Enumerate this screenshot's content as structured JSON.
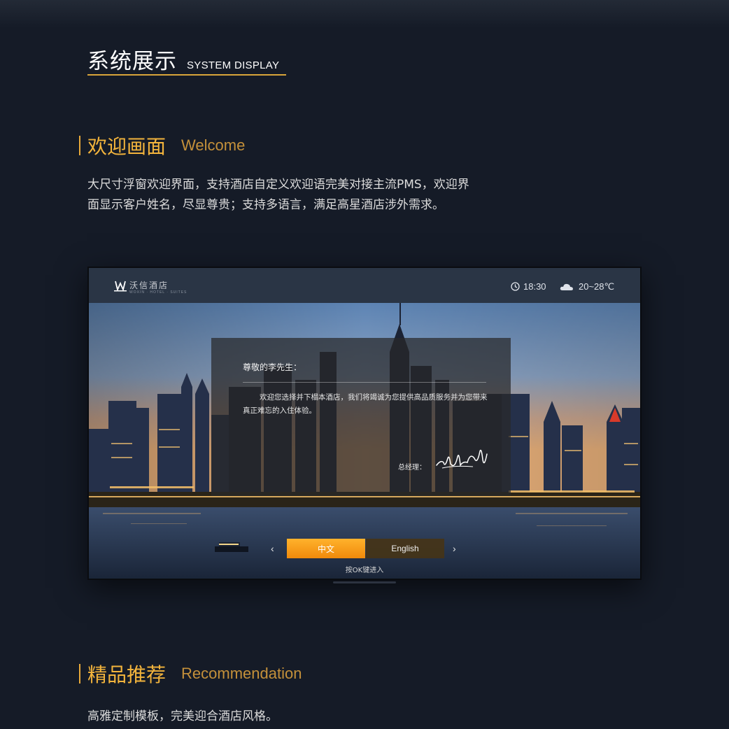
{
  "header": {
    "title_zh": "系统展示",
    "title_en": "SYSTEM DISPLAY"
  },
  "section_welcome": {
    "title_zh": "欢迎画面",
    "title_en": "Welcome",
    "description_line1": "大尺寸浮窗欢迎界面，支持酒店自定义欢迎语完美对接主流PMS，欢迎界",
    "description_line2": "面显示客户姓名，尽显尊贵；支持多语言，满足高星酒店涉外需求。"
  },
  "tv": {
    "logo_text": "沃信酒店",
    "logo_sub": "WOXIN · HOTEL · SUITES",
    "time": "18:30",
    "temperature": "20~28℃",
    "icons": {
      "clock": "clock-icon",
      "weather": "cloud-icon",
      "logo": "w-logo-icon"
    },
    "welcome": {
      "greeting": "尊敬的李先生：",
      "message": "欢迎您选择并下榻本酒店，我们将竭诚为您提供高品质服务并为您带来真正难忘的入住体验。",
      "signoff": "总经理："
    },
    "language": {
      "prev": "‹",
      "next": "›",
      "options": [
        "中文",
        "English"
      ],
      "selected": "中文"
    },
    "ok_hint": "按OK键进入"
  },
  "section_recommend": {
    "title_zh": "精品推荐",
    "title_en": "Recommendation",
    "description": "高雅定制模板，完美迎合酒店风格。"
  },
  "colors": {
    "background": "#151b27",
    "accent": "#f3b43c",
    "accent_dark": "#c4903a",
    "button_selected": "#f7a21c"
  }
}
